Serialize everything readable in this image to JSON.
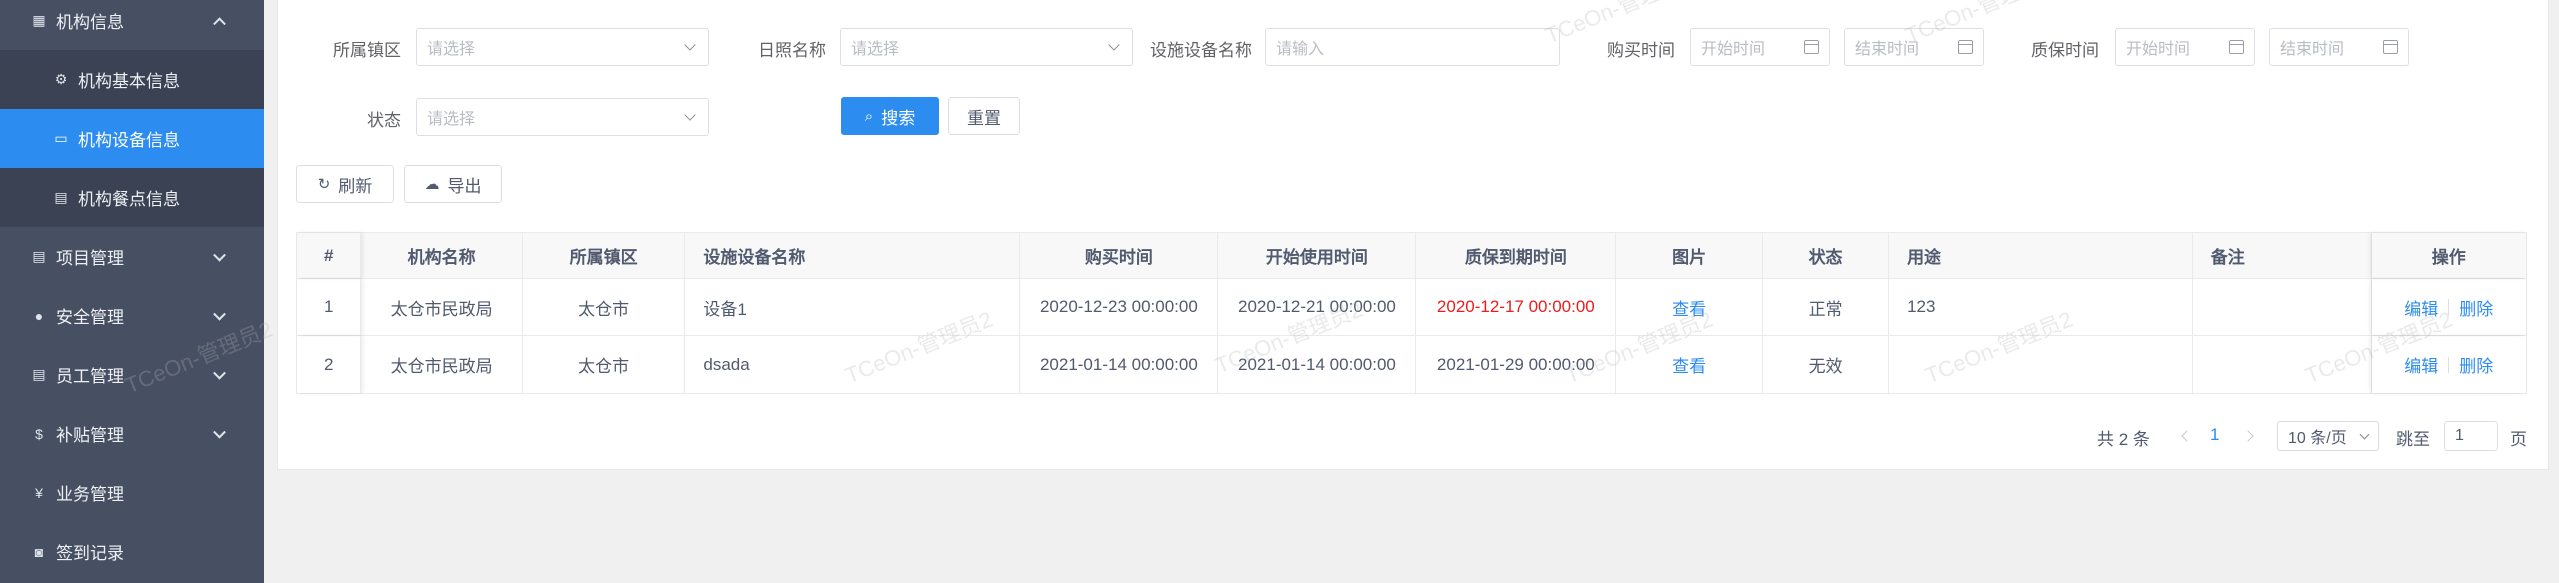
{
  "sidebar": {
    "items": [
      {
        "label": "机构信息",
        "icon": "grid-icon"
      },
      {
        "label": "机构基本信息",
        "icon": "settings-icon"
      },
      {
        "label": "机构设备信息",
        "icon": "monitor-icon"
      },
      {
        "label": "机构餐点信息",
        "icon": "document-icon"
      },
      {
        "label": "项目管理",
        "icon": "document-icon"
      },
      {
        "label": "安全管理",
        "icon": "location-icon"
      },
      {
        "label": "员工管理",
        "icon": "document-icon"
      },
      {
        "label": "补贴管理",
        "icon": "dollar-icon"
      },
      {
        "label": "业务管理",
        "icon": "yen-icon"
      },
      {
        "label": "签到记录",
        "icon": "bag-icon"
      }
    ]
  },
  "filters": {
    "district_label": "所属镇区",
    "district_placeholder": "请选择",
    "date_name_label": "日照名称",
    "date_name_placeholder": "请选择",
    "device_label": "设施设备名称",
    "device_placeholder": "请输入",
    "purchase_label": "购买时间",
    "purchase_start": "开始时间",
    "purchase_end": "结束时间",
    "warranty_label": "质保时间",
    "warranty_start": "开始时间",
    "warranty_end": "结束时间",
    "status_label": "状态",
    "status_placeholder": "请选择",
    "search_button": "搜索",
    "reset_button": "重置"
  },
  "toolbar": {
    "refresh_label": "刷新",
    "export_label": "导出"
  },
  "table": {
    "columns": [
      "#",
      "机构名称",
      "所属镇区",
      "设施设备名称",
      "购买时间",
      "开始使用时间",
      "质保到期时间",
      "图片",
      "状态",
      "用途",
      "备注",
      "操作"
    ],
    "rows": [
      {
        "index": "1",
        "org": "太仓市民政局",
        "district": "太仓市",
        "device": "设备1",
        "purchase": "2020-12-23 00:00:00",
        "start_use": "2020-12-21 00:00:00",
        "warranty_end": "2020-12-17 00:00:00",
        "image": "查看",
        "status": "正常",
        "usage": "123",
        "note": "",
        "edit": "编辑",
        "delete": "删除"
      },
      {
        "index": "2",
        "org": "太仓市民政局",
        "district": "太仓市",
        "device": "dsada",
        "purchase": "2021-01-14 00:00:00",
        "start_use": "2021-01-14 00:00:00",
        "warranty_end": "2021-01-29 00:00:00",
        "image": "查看",
        "status": "无效",
        "usage": "",
        "note": "",
        "edit": "编辑",
        "delete": "删除"
      }
    ]
  },
  "pagination": {
    "total_text": "共 2 条",
    "current_page": "1",
    "page_size": "10 条/页",
    "jump_label": "跳至",
    "jump_value": "1",
    "page_unit": "页"
  },
  "watermark": "TCeOn-管理员2",
  "colors": {
    "sidebar_bg": "#475063",
    "active_bg": "#2d8cf0",
    "primary": "#2d8cf0",
    "danger_text": "#ed1c1c"
  }
}
